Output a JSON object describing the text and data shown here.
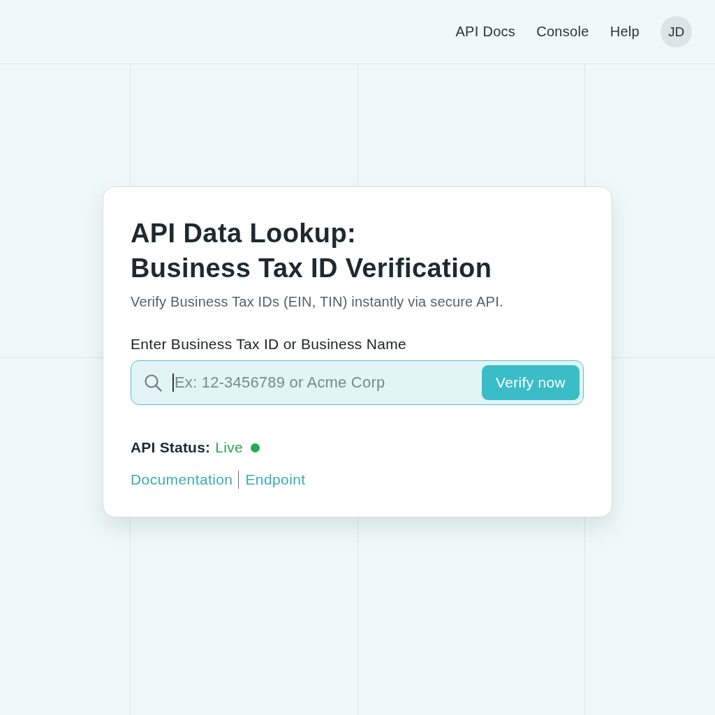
{
  "nav": {
    "links": [
      "API Docs",
      "Console",
      "Help"
    ],
    "avatar": "JD"
  },
  "card": {
    "title": "API Data Lookup:\nBusiness Tax ID Verification",
    "subtitle": "Verify Business Tax IDs (EIN, TIN) instantly via secure API.",
    "search": {
      "label": "Enter Business Tax ID or Business Name",
      "placeholder": "Ex: 12-3456789 or Acme Corp",
      "button": "Verify now"
    },
    "status": {
      "label": "API Status:",
      "value": "Live",
      "on": true
    },
    "links": [
      "Documentation",
      "Endpoint"
    ]
  }
}
